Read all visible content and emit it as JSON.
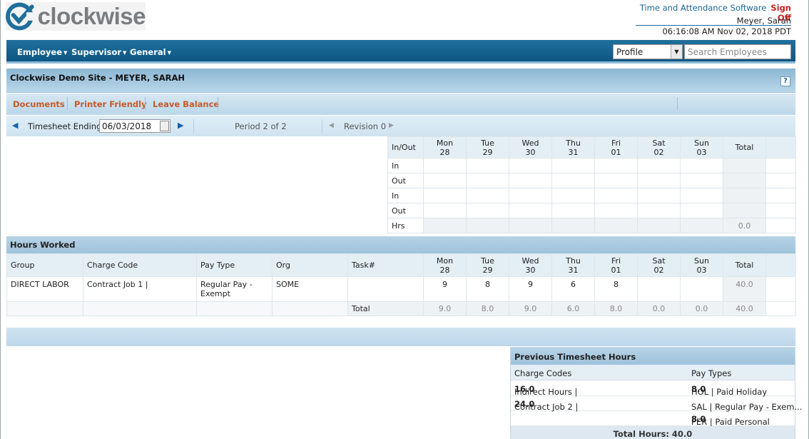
{
  "app": {
    "logo_text": "clockwise"
  },
  "topbar": {
    "software_link": "Time and Attendance Software",
    "sign_off": "Sign Off",
    "user_name": "Meyer, Sarah",
    "datetime": "06:16:08 AM Nov 02, 2018 PDT"
  },
  "nav": {
    "items": [
      "Employee",
      "Supervisor",
      "General"
    ],
    "profile_value": "Profile",
    "search_placeholder": "Search Employees"
  },
  "site": {
    "title": "Clockwise Demo Site - MEYER, SARAH",
    "help": "?"
  },
  "links": [
    "Documents",
    "Printer Friendly",
    "Leave Balance"
  ],
  "timesheet": {
    "ending_label": "Timesheet Ending:",
    "ending_value": "06/03/2018",
    "period": "Period 2 of 2",
    "revision": "Revision 0"
  },
  "punch": {
    "header_label": "In/Out",
    "days": [
      {
        "d": "Mon",
        "n": "28"
      },
      {
        "d": "Tue",
        "n": "29"
      },
      {
        "d": "Wed",
        "n": "30"
      },
      {
        "d": "Thu",
        "n": "31"
      },
      {
        "d": "Fri",
        "n": "01"
      },
      {
        "d": "Sat",
        "n": "02"
      },
      {
        "d": "Sun",
        "n": "03"
      }
    ],
    "total_label": "Total",
    "rows": [
      "In",
      "Out",
      "In",
      "Out",
      "Hrs"
    ],
    "hrs_total": "0.0"
  },
  "hours_worked": {
    "title": "Hours Worked",
    "columns": [
      "Group",
      "Charge Code",
      "Pay Type",
      "Org",
      "Task#"
    ],
    "total_label": "Total",
    "row": {
      "group": "DIRECT LABOR",
      "charge_code": "Contract Job 1 |",
      "pay_type": "Regular Pay - Exempt",
      "org": "SOME",
      "task": "",
      "hours": [
        "9",
        "8",
        "9",
        "6",
        "8",
        "",
        ""
      ],
      "total": "40.0"
    },
    "totals_label": "Total",
    "totals": [
      "9.0",
      "8.0",
      "9.0",
      "6.0",
      "8.0",
      "0.0",
      "0.0"
    ],
    "grand_total": "40.0"
  },
  "previous": {
    "title": "Previous Timesheet Hours",
    "col_charge": "Charge Codes",
    "col_pay": "Pay Types",
    "charge": [
      {
        "label": "Indirect Hours |",
        "value": "16.0"
      },
      {
        "label": "Contract Job 2 |",
        "value": "24.0"
      }
    ],
    "pay": [
      {
        "label": "HOL | Paid Holiday",
        "value": "8.0"
      },
      {
        "label": "SAL | Regular Pay - Exem...",
        "value": ""
      },
      {
        "label": "PER | Paid Personal",
        "value": "8.0"
      }
    ],
    "total": "Total Hours: 40.0"
  },
  "colors": {
    "nav": "#0d5784",
    "accent_link": "#c65a2a",
    "sign_off": "#cc1f1f"
  }
}
